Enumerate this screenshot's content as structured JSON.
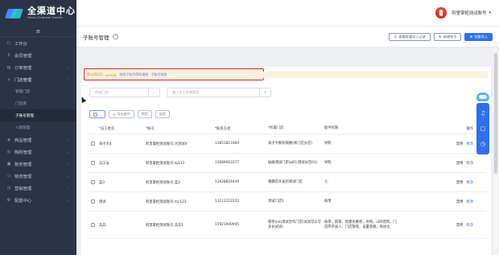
{
  "brand": {
    "title": "全渠道中心",
    "subtitle": "Omni-Channel Center"
  },
  "user": {
    "name": "阿里掌柜测试账号",
    "caret": "▾"
  },
  "sidebar": {
    "collapse_icon": "≡",
    "items": [
      {
        "icon": "☐",
        "label": "工作台",
        "chevron": ""
      },
      {
        "icon": "⊼",
        "label": "会员管理",
        "chevron": "⌄"
      },
      {
        "icon": "▤",
        "label": "订单管理",
        "chevron": "⌄"
      },
      {
        "icon": "⌂",
        "label": "门店管理",
        "chevron": "⌃"
      }
    ],
    "subitems": [
      {
        "label": "管理门店"
      },
      {
        "label": "门店库"
      },
      {
        "label": "子账号管理"
      },
      {
        "label": "入职管理"
      }
    ],
    "items_after": [
      {
        "icon": "◈",
        "label": "商品管理",
        "chevron": "⌄"
      },
      {
        "icon": "◎",
        "label": "陶则管理",
        "chevron": "⌄"
      },
      {
        "icon": "▣",
        "label": "账务管理",
        "chevron": "⌄"
      },
      {
        "icon": "▭",
        "label": "物流管理",
        "chevron": "⌄"
      },
      {
        "icon": "◷",
        "label": "营销管理",
        "chevron": "⌄"
      },
      {
        "icon": "⚙",
        "label": "配置中心",
        "chevron": "⌄"
      }
    ]
  },
  "page": {
    "title": "子账号管理",
    "help": "?",
    "actions": [
      {
        "icon": "◷",
        "label": "查看批量导入记录",
        "primary": false
      },
      {
        "icon": "⊕",
        "label": "新增账号",
        "primary": false
      },
      {
        "icon": "⊕",
        "label": "批量导入",
        "primary": true
      }
    ]
  },
  "notice": {
    "prefix": "默认密码为",
    "account": "xxxxxx",
    "middle": "修改子账号密码请到",
    "link": "子账号系统"
  },
  "filters": {
    "store_select": "所有门店",
    "store_arrow": "⌄",
    "search_placeholder": "输入员工名称搜索",
    "search_icon": "⌕"
  },
  "bulk": {
    "select_all": "⌄",
    "export_label": "导出选中",
    "disable_label": "禁用",
    "enable_label": "启用"
  },
  "table": {
    "headers": {
      "name": "*员工姓名",
      "account": "*账号",
      "phone": "*联系方式",
      "store": "*所属门店",
      "perm": "能手权限",
      "op": "操作"
    },
    "rows": [
      {
        "name": "海子大4",
        "account": "阿里掌柜测试账号:大测试4",
        "phone": "13851821604",
        "store": "海子大数有限路(体门店分店)",
        "perm": "导购",
        "perm_blue": false,
        "disable": "禁用",
        "edit": "修改"
      },
      {
        "name": "员工lq",
        "account": "阿里掌柜测试账号:lq333",
        "phone": "13666663377",
        "store": "振展测试门店lq01(测试分店01)",
        "perm": "导购",
        "perm_blue": false,
        "disable": "禁用",
        "edit": "修改"
      },
      {
        "name": "蓝3",
        "account": "阿里掌柜测试账号:蓝3",
        "phone": "13928824449",
        "store": "春藤店开发的测试门店",
        "perm": "无",
        "perm_blue": true,
        "disable": "禁用",
        "edit": "修改"
      },
      {
        "name": "测试",
        "account": "阿里掌柜测试账号:mc123",
        "phone": "13111112222",
        "store": "测试门店1",
        "perm": "核单",
        "perm_blue": false,
        "disable": "禁用",
        "edit": "修改"
      },
      {
        "name": "兵兵",
        "account": "阿里掌柜测试账号:兵兵1",
        "phone": "15921940945",
        "store": "新修mm测试合作门店(试试可以写多长试试)",
        "perm": "核单，销销，创建优惠券，导购，LBS营销，门店库存录入，门店管理，设置客服，拖动仪",
        "perm_blue": false,
        "disable": "禁用",
        "edit": "修改"
      }
    ]
  },
  "float_tools": [
    "♫",
    "▢",
    "◷"
  ]
}
